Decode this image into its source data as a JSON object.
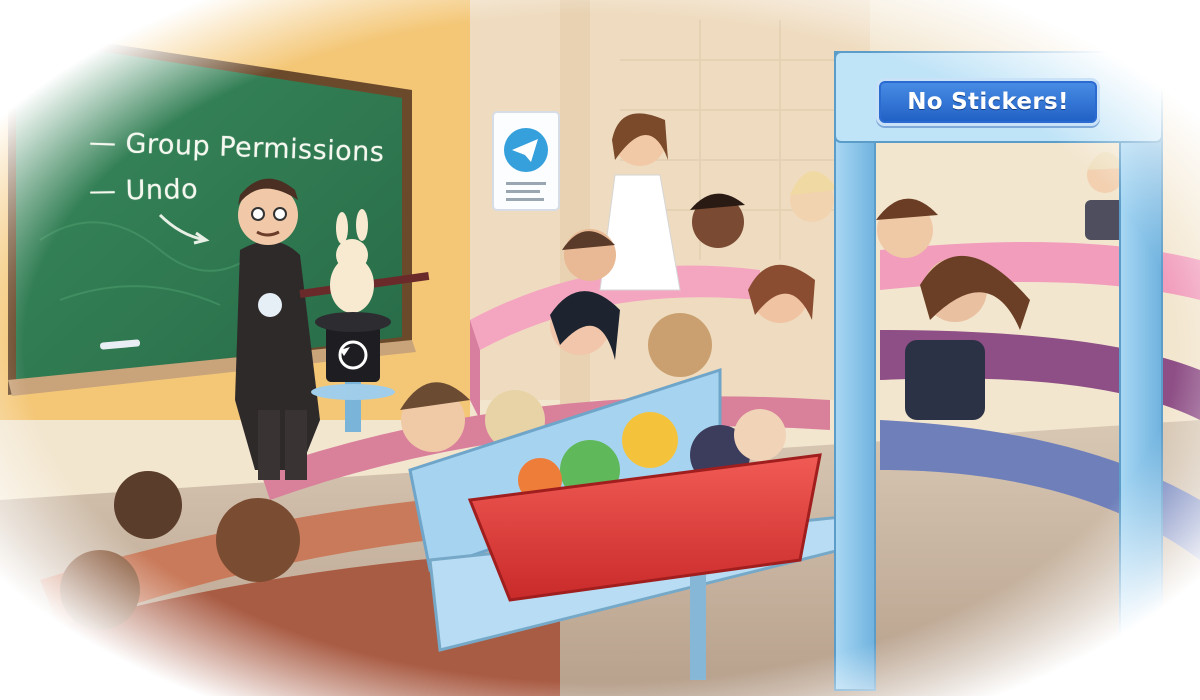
{
  "image": {
    "chalkboard": {
      "line1": "— Group Permissions",
      "line2": "— Undo"
    },
    "sign": {
      "text": "No Stickers!"
    },
    "poster_icon": "telegram-paper-plane-icon",
    "hat_icon": "undo-arrow-icon",
    "colors": {
      "chalkboard": "#2f7a52",
      "wall": "#f2d9a8",
      "seats": "#e989a8",
      "gate": "#8fc7ec",
      "bin": "#e23b3b",
      "sign": "#2b6fd6"
    }
  }
}
